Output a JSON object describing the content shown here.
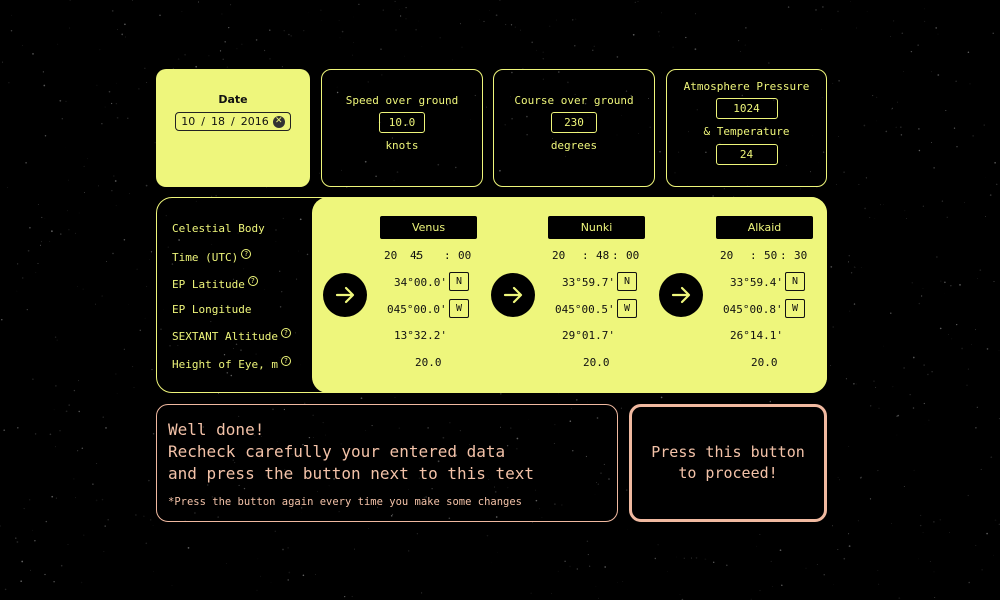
{
  "date": {
    "label": "Date",
    "month": "10",
    "day": "18",
    "year": "2016"
  },
  "speed": {
    "label": "Speed over ground",
    "value": "10.0",
    "unit": "knots"
  },
  "course": {
    "label": "Course over ground",
    "value": "230",
    "unit": "degrees"
  },
  "atmosphere": {
    "label_pressure": "Atmosphere Pressure",
    "pressure": "1024",
    "label_temp": "& Temperature",
    "temperature": "24"
  },
  "rows": {
    "body": "Celestial Body",
    "time": "Time (UTC)",
    "lat": "EP Latitude",
    "lon": "EP Longitude",
    "sextant": "SEXTANT Altitude",
    "height": "Height of Eye, m"
  },
  "help_symbol": "?",
  "observations": [
    {
      "body": "Venus",
      "hh": "20",
      "mm": "45",
      "ss": "00",
      "lat": "34°00.0'",
      "lat_hemi": "N",
      "lon": "045°00.0'",
      "lon_hemi": "W",
      "sextant": "13°32.2'",
      "height": "20.0"
    },
    {
      "body": "Nunki",
      "hh": "20",
      "mm": "48",
      "ss": "00",
      "lat": "33°59.7'",
      "lat_hemi": "N",
      "lon": "045°00.5'",
      "lon_hemi": "W",
      "sextant": "29°01.7'",
      "height": "20.0"
    },
    {
      "body": "Alkaid",
      "hh": "20",
      "mm": "50",
      "ss": "30",
      "lat": "33°59.4'",
      "lat_hemi": "N",
      "lon": "045°00.8'",
      "lon_hemi": "W",
      "sextant": "26°14.1'",
      "height": "20.0"
    }
  ],
  "message": {
    "line1": "Well done!",
    "line2": "Recheck carefully your entered data",
    "line3": "and press the button next to this text",
    "note": "*Press the button again every time you make some changes"
  },
  "proceed": {
    "line1": "Press this button",
    "line2": "to proceed!"
  },
  "colors": {
    "accent": "#eef67c",
    "message": "#f3c2a8",
    "background": "#000000"
  }
}
